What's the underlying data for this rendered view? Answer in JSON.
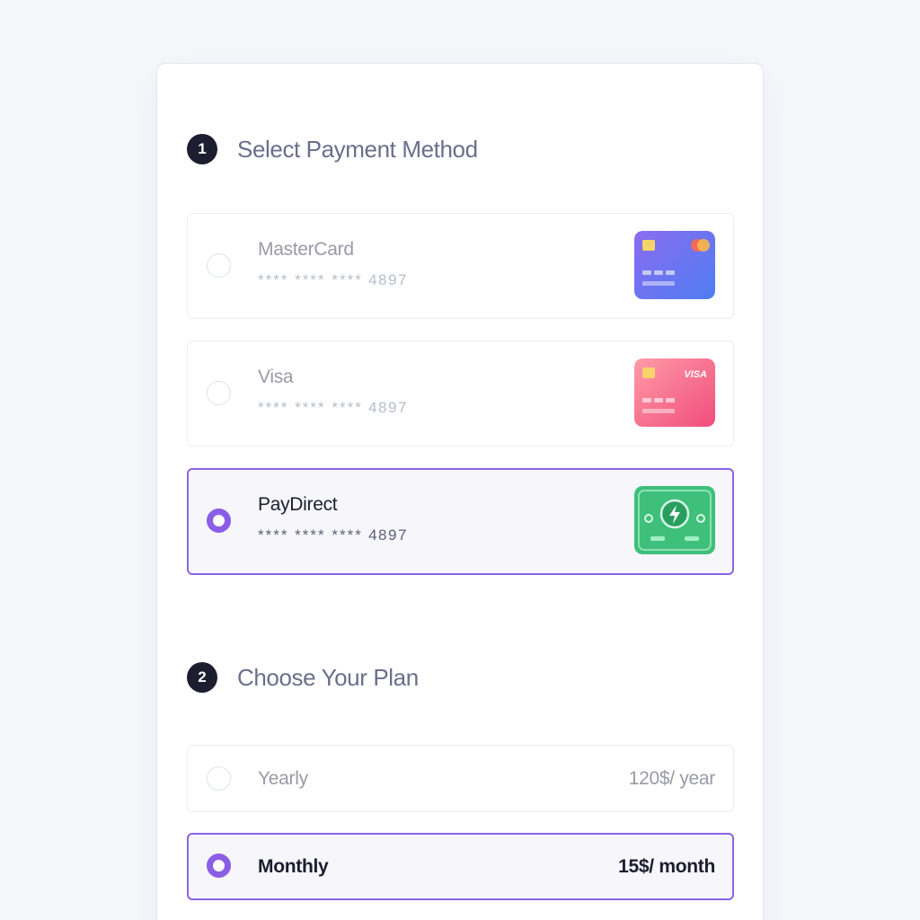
{
  "payment": {
    "step": "1",
    "title": "Select Payment Method",
    "methods": [
      {
        "name": "MasterCard",
        "mask": "**** **** ****",
        "last4": "4897",
        "selected": false,
        "card_icon": "mastercard-card-icon"
      },
      {
        "name": "Visa",
        "mask": "**** **** ****",
        "last4": "4897",
        "selected": false,
        "card_icon": "visa-card-icon",
        "brand_text": "VISA"
      },
      {
        "name": "PayDirect",
        "mask": "**** **** ****",
        "last4": "4897",
        "selected": true,
        "card_icon": "cash-bill-icon"
      }
    ]
  },
  "plan": {
    "step": "2",
    "title": "Choose Your Plan",
    "options": [
      {
        "name": "Yearly",
        "price": "120$/ year",
        "selected": false
      },
      {
        "name": "Monthly",
        "price": "15$/ month",
        "selected": true
      }
    ]
  },
  "colors": {
    "accent": "#8b5ee6",
    "badge": "#1c1d2e",
    "mastercard_gradient": [
      "#8a6cf0",
      "#4f7df2"
    ],
    "visa_gradient": [
      "#ff9aa8",
      "#f04e7c"
    ],
    "cash": "#3ec07a"
  }
}
